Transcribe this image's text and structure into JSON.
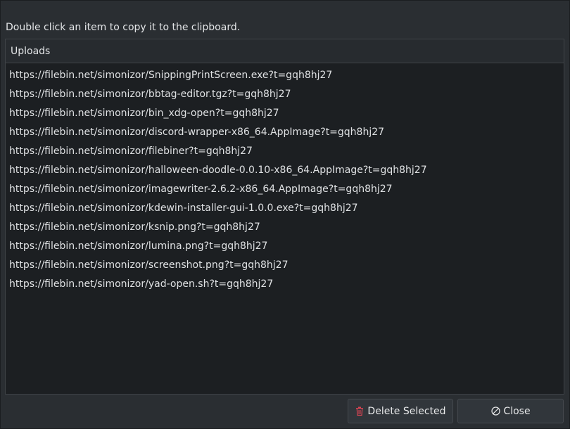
{
  "instruction": "Double click an item to copy it to the clipboard.",
  "list": {
    "header": "Uploads",
    "items": [
      "https://filebin.net/simonizor/SnippingPrintScreen.exe?t=gqh8hj27",
      "https://filebin.net/simonizor/bbtag-editor.tgz?t=gqh8hj27",
      "https://filebin.net/simonizor/bin_xdg-open?t=gqh8hj27",
      "https://filebin.net/simonizor/discord-wrapper-x86_64.AppImage?t=gqh8hj27",
      "https://filebin.net/simonizor/filebiner?t=gqh8hj27",
      "https://filebin.net/simonizor/halloween-doodle-0.0.10-x86_64.AppImage?t=gqh8hj27",
      "https://filebin.net/simonizor/imagewriter-2.6.2-x86_64.AppImage?t=gqh8hj27",
      "https://filebin.net/simonizor/kdewin-installer-gui-1.0.0.exe?t=gqh8hj27",
      "https://filebin.net/simonizor/ksnip.png?t=gqh8hj27",
      "https://filebin.net/simonizor/lumina.png?t=gqh8hj27",
      "https://filebin.net/simonizor/screenshot.png?t=gqh8hj27",
      "https://filebin.net/simonizor/yad-open.sh?t=gqh8hj27"
    ]
  },
  "buttons": {
    "delete_label": "Delete Selected",
    "delete_icon": "trash-icon",
    "close_label": "Close",
    "close_icon": "cancel-icon"
  },
  "colors": {
    "background": "#2a2e32",
    "list_background": "#1c1f22",
    "delete_icon": "#da4453"
  }
}
